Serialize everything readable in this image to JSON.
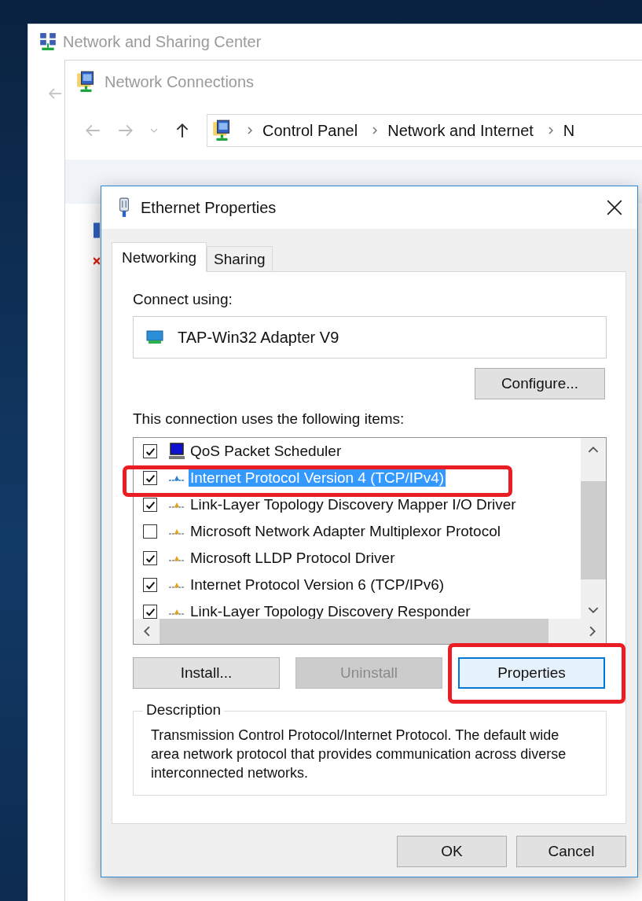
{
  "background_windows": [
    {
      "title": "Network and Sharing Center"
    },
    {
      "title": "Network Connections"
    }
  ],
  "address_bar": {
    "breadcrumbs": [
      "Control Panel",
      "Network and Internet",
      "N"
    ]
  },
  "dialog": {
    "title": "Ethernet Properties",
    "tabs": [
      {
        "label": "Networking",
        "selected": true
      },
      {
        "label": "Sharing",
        "selected": false
      }
    ],
    "connect_label": "Connect using:",
    "adapter": "TAP-Win32 Adapter V9",
    "configure_button": "Configure...",
    "items_label": "This connection uses the following items:",
    "items": [
      {
        "kind": "service",
        "label": "QoS Packet Scheduler",
        "checked": true,
        "selected": false,
        "highlighted": false
      },
      {
        "kind": "protocol",
        "label": "Internet Protocol Version 4 (TCP/IPv4)",
        "checked": true,
        "selected": true,
        "highlighted": true
      },
      {
        "kind": "protocol",
        "label": "Link-Layer Topology Discovery Mapper I/O Driver",
        "checked": true,
        "selected": false,
        "highlighted": false
      },
      {
        "kind": "protocol",
        "label": "Microsoft Network Adapter Multiplexor Protocol",
        "checked": false,
        "selected": false,
        "highlighted": false
      },
      {
        "kind": "protocol",
        "label": "Microsoft LLDP Protocol Driver",
        "checked": true,
        "selected": false,
        "highlighted": false
      },
      {
        "kind": "protocol",
        "label": "Internet Protocol Version 6 (TCP/IPv6)",
        "checked": true,
        "selected": false,
        "highlighted": false
      },
      {
        "kind": "protocol",
        "label": "Link-Layer Topology Discovery Responder",
        "checked": true,
        "selected": false,
        "highlighted": false
      }
    ],
    "item_buttons": [
      {
        "label": "Install...",
        "disabled": false,
        "focused": false,
        "highlighted": false
      },
      {
        "label": "Uninstall",
        "disabled": true,
        "focused": false,
        "highlighted": false
      },
      {
        "label": "Properties",
        "disabled": false,
        "focused": true,
        "highlighted": true
      }
    ],
    "description": {
      "legend": "Description",
      "text": "Transmission Control Protocol/Internet Protocol. The default wide area network protocol that provides communication across diverse interconnected networks."
    },
    "footer_buttons": [
      "OK",
      "Cancel"
    ]
  }
}
